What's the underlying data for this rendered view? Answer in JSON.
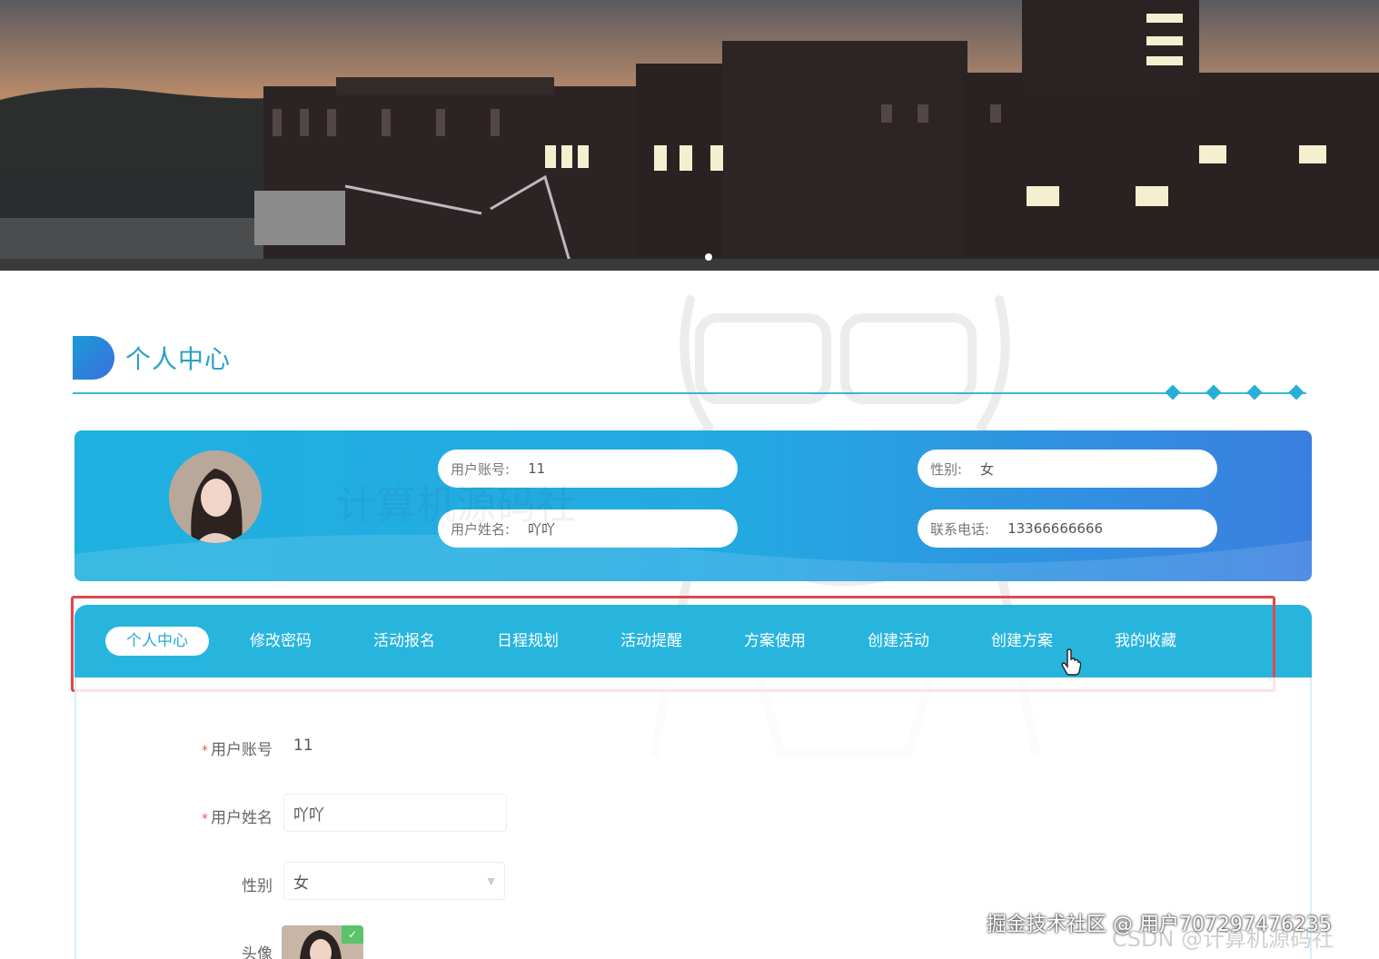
{
  "banner": {
    "carousel_active_index": 0
  },
  "page_title": "个人中心",
  "profile_summary": {
    "account_label": "用户账号:",
    "account_value": "11",
    "gender_label": "性别:",
    "gender_value": "女",
    "name_label": "用户姓名:",
    "name_value": "吖吖",
    "phone_label": "联系电话:",
    "phone_value": "13366666666"
  },
  "tabs": [
    {
      "label": "个人中心",
      "active": true
    },
    {
      "label": "修改密码",
      "active": false
    },
    {
      "label": "活动报名",
      "active": false
    },
    {
      "label": "日程规划",
      "active": false
    },
    {
      "label": "活动提醒",
      "active": false
    },
    {
      "label": "方案使用",
      "active": false
    },
    {
      "label": "创建活动",
      "active": false
    },
    {
      "label": "创建方案",
      "active": false
    },
    {
      "label": "我的收藏",
      "active": false
    }
  ],
  "form": {
    "required_mark": "*",
    "account_label": "用户账号",
    "account_value": "11",
    "name_label": "用户姓名",
    "name_value": "吖吖",
    "gender_label": "性别",
    "gender_value": "女",
    "avatar_label": "头像"
  },
  "watermarks": {
    "juejin": "掘金技术社区 @ 用户707297476235",
    "csdn": "CSDN @计算机源码社",
    "faint": "计算机源码社"
  },
  "colors": {
    "primary": "#27b5de",
    "title": "#2aa0c8",
    "highlight_border": "#e5464c"
  },
  "icons": {
    "cursor": "hand-pointer-icon",
    "avatar_check": "check-icon"
  }
}
